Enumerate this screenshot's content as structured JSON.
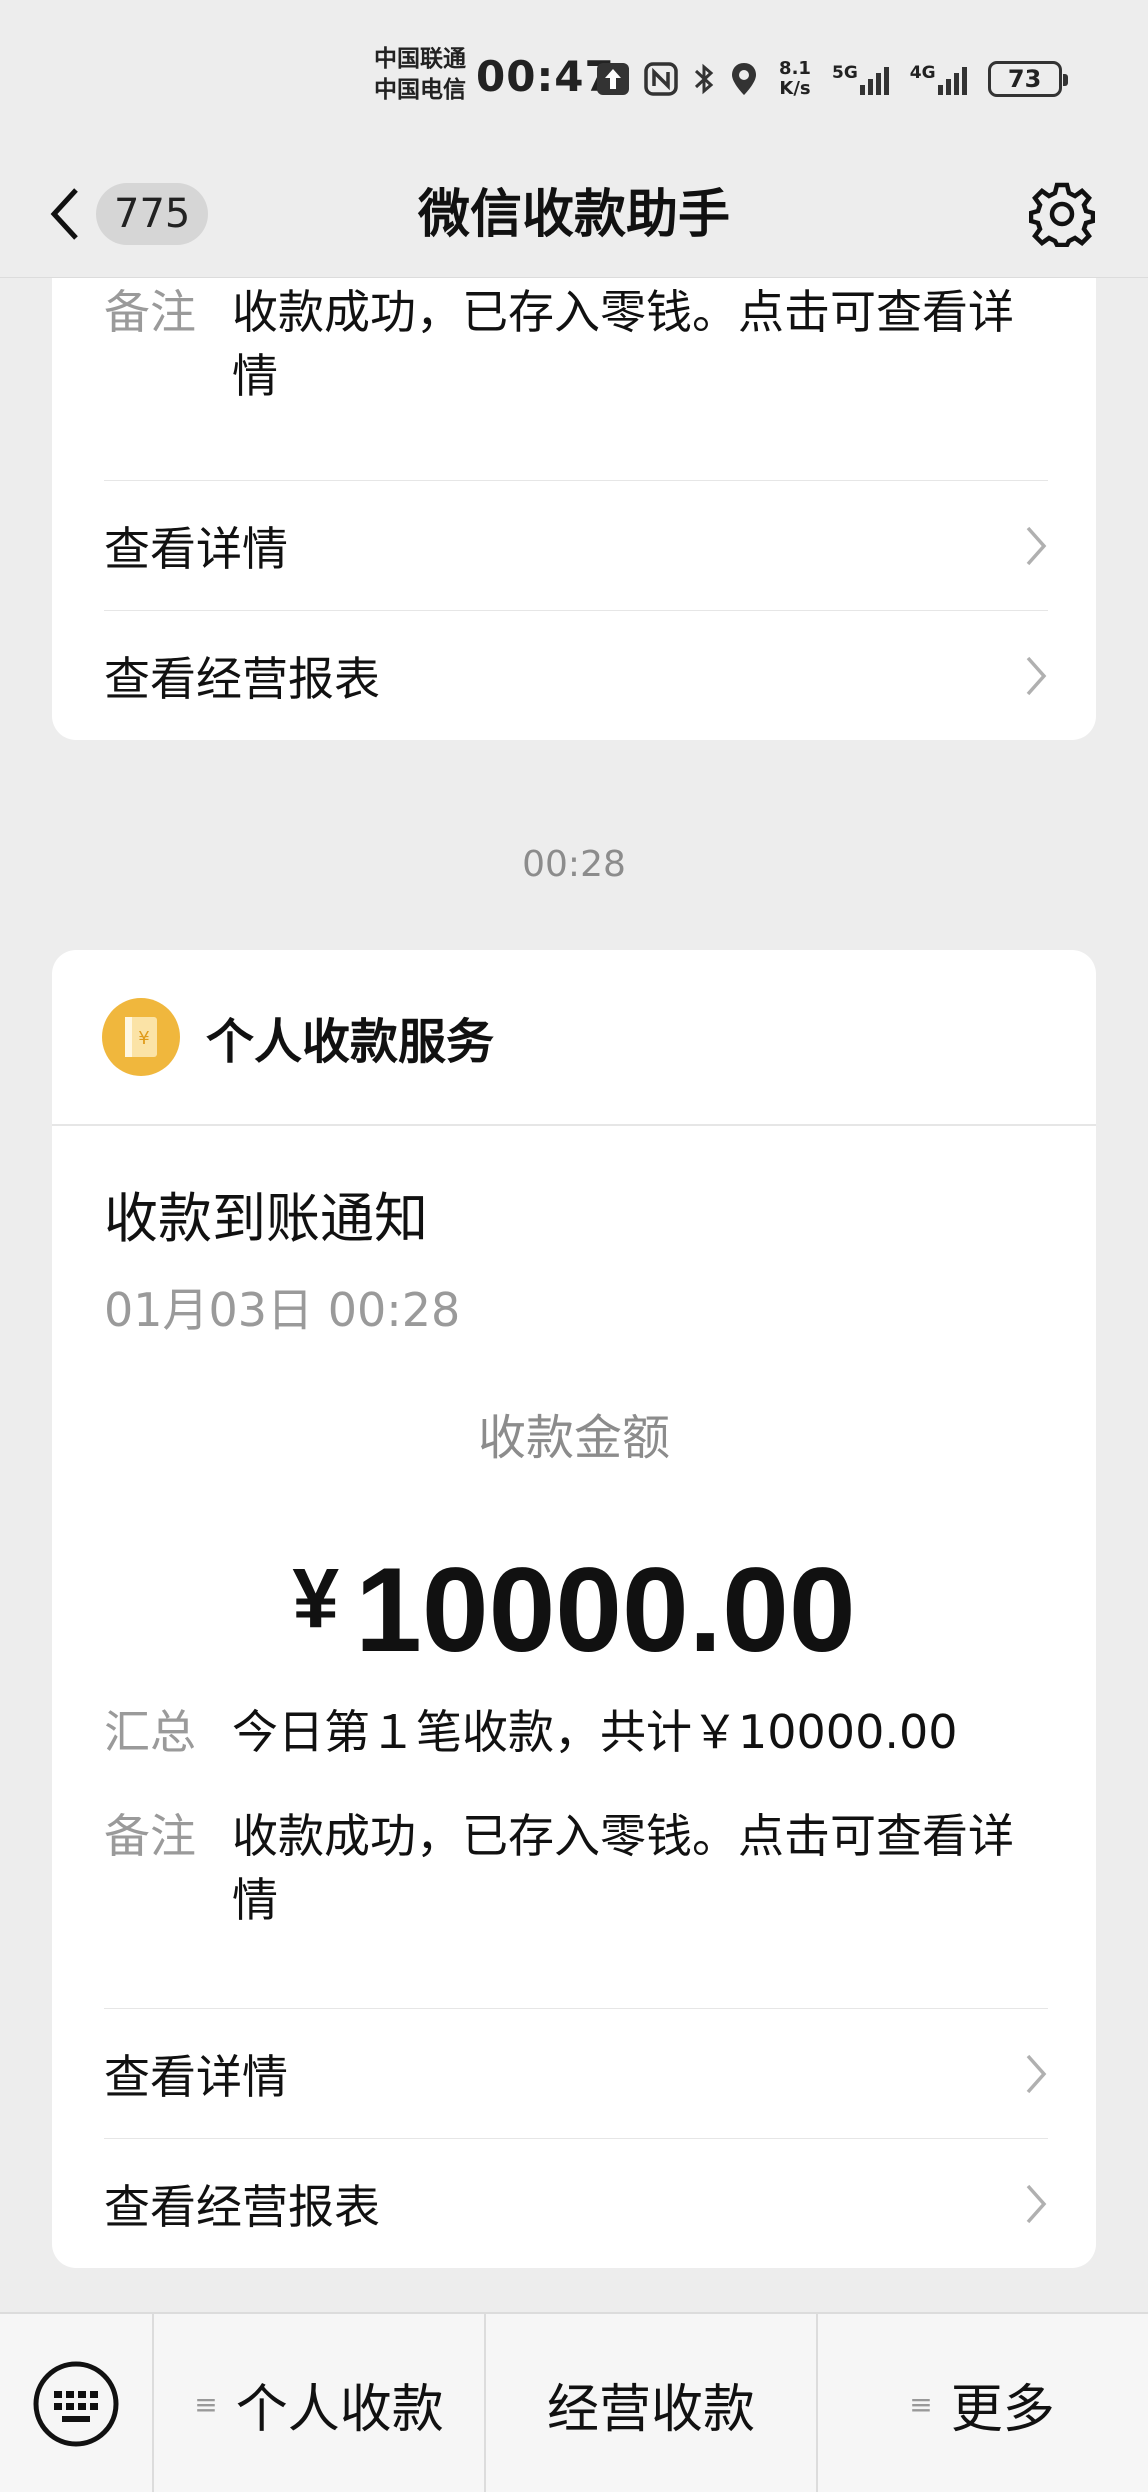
{
  "status_bar": {
    "carrier_1": "中国联通",
    "carrier_2": "中国电信",
    "time": "00:47",
    "speed_value": "8.1",
    "speed_unit": "K/s",
    "net_1": "5G",
    "net_2": "4G",
    "battery": "73"
  },
  "nav": {
    "unread_count": "775",
    "title": "微信收款助手"
  },
  "first_card": {
    "remark_key": "备注",
    "remark_line1": "收款成功，已存入零钱。点击可查看详",
    "remark_line2": "情",
    "link_details": "查看详情",
    "link_report": "查看经营报表"
  },
  "timestamp": "00:28",
  "second_card": {
    "service_name": "个人收款服务",
    "notice_title": "收款到账通知",
    "notice_date": "01月03日 00:28",
    "amount_label": "收款金额",
    "currency": "¥",
    "amount": "10000.00",
    "summary_key": "汇总",
    "summary_value": "今日第１笔收款，共计￥10000.00",
    "remark_key": "备注",
    "remark_line1": "收款成功，已存入零钱。点击可查看详",
    "remark_line2": "情",
    "link_details": "查看详情",
    "link_report": "查看经营报表"
  },
  "bottom_menu": {
    "item_1": "个人收款",
    "item_2": "经营收款",
    "item_3": "更多"
  },
  "colors": {
    "background": "#ededed",
    "card": "#ffffff",
    "service_icon": "#f0b73d",
    "muted_text": "#9a9a9a"
  }
}
